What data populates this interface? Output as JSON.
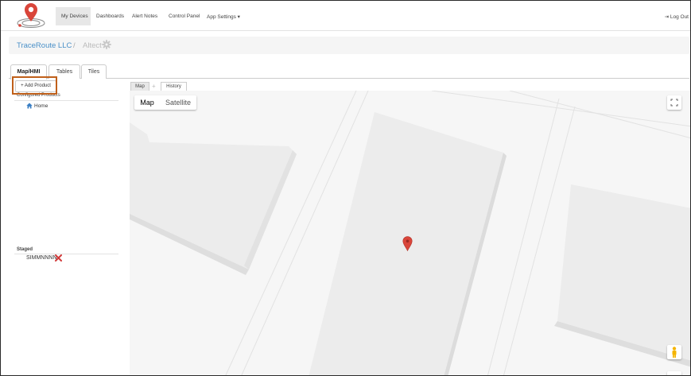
{
  "nav": {
    "items": [
      "My Devices",
      "Dashboards",
      "Alert Notes",
      "Control Panel",
      "App Settings ▾"
    ],
    "logout": "Log Out"
  },
  "breadcrumb": {
    "company": "TraceRoute LLC",
    "separator": "/",
    "current": "Altect"
  },
  "tabs": [
    "Map/HMI",
    "Tables",
    "Tiles"
  ],
  "sidebar": {
    "add_product": "+ Add Product",
    "configured_label": "Configured Products",
    "home_label": "Home",
    "staged_label": "Staged",
    "staged_items": [
      "SIMMNNNN"
    ]
  },
  "map_tabs": [
    "Map",
    "+",
    "History"
  ],
  "map": {
    "type_map": "Map",
    "type_satellite": "Satellite"
  },
  "icons": {
    "logo": "location-pin-logo-icon",
    "gear": "gear-icon",
    "home": "home-icon",
    "remove": "x-icon",
    "fullscreen": "fullscreen-icon",
    "pegman": "pegman-icon",
    "marker": "map-marker-icon",
    "logout": "logout-icon"
  },
  "colors": {
    "link": "#4a90c8",
    "highlight": "#c0601a",
    "marker": "#d9453a",
    "remove": "#d23b3b"
  }
}
